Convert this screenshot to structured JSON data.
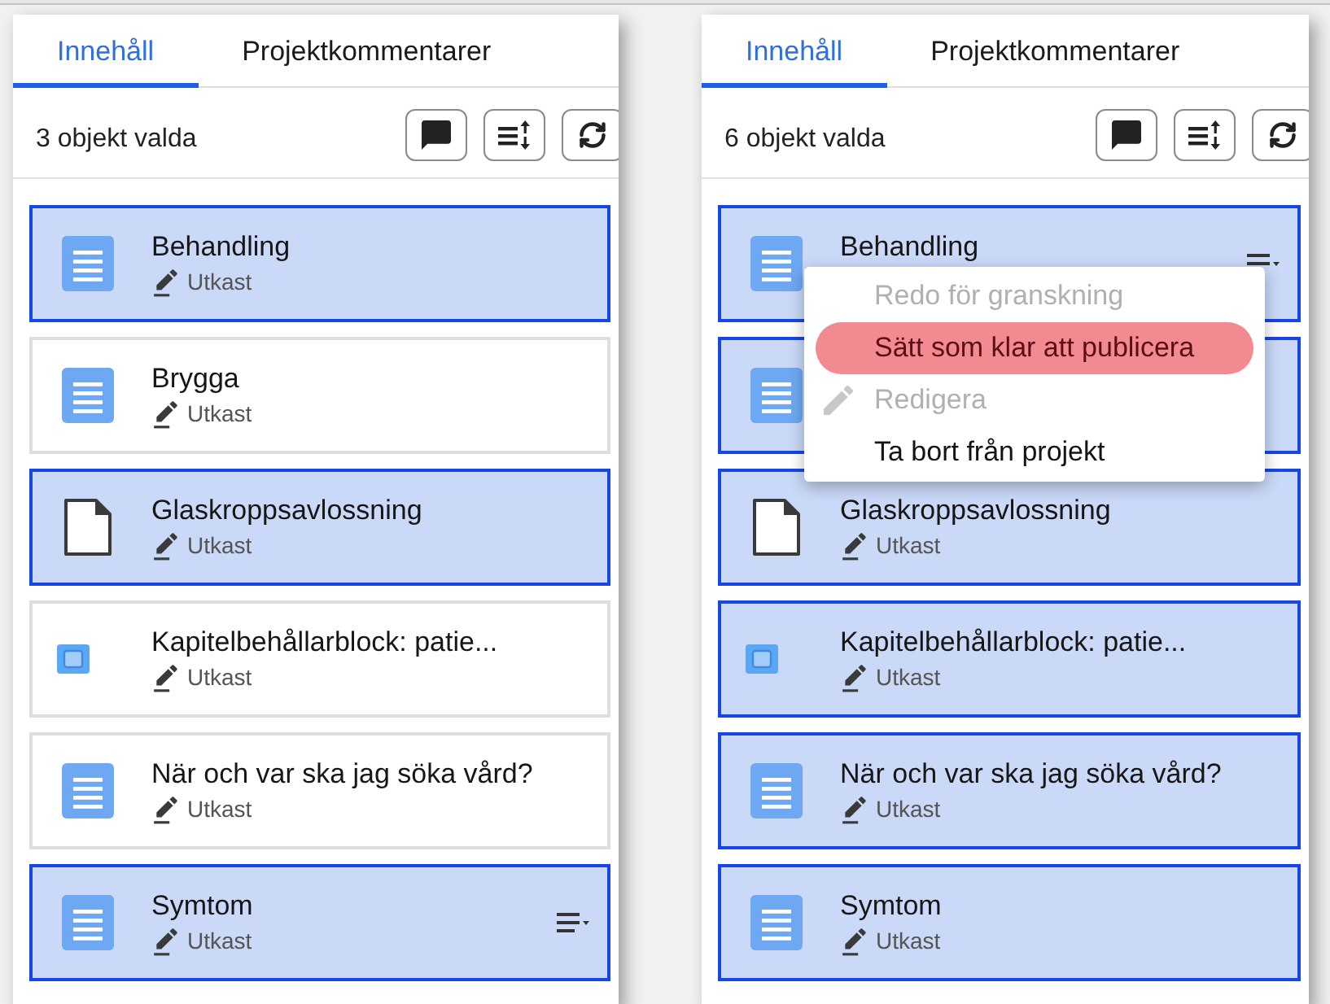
{
  "panels": [
    {
      "tabs": [
        {
          "label": "Innehåll",
          "selected": true
        },
        {
          "label": "Projektkommentarer",
          "selected": false
        }
      ],
      "selection_count": "3 objekt valda",
      "items": [
        {
          "title": "Behandling",
          "status": "Utkast",
          "kind": "text",
          "selected": true,
          "menu_button": false
        },
        {
          "title": "Brygga",
          "status": "Utkast",
          "kind": "text",
          "selected": false,
          "menu_button": false
        },
        {
          "title": "Glaskroppsavlossning",
          "status": "Utkast",
          "kind": "page",
          "selected": true,
          "menu_button": false
        },
        {
          "title": "Kapitelbehållarblock: patie...",
          "status": "Utkast",
          "kind": "block",
          "selected": false,
          "menu_button": false
        },
        {
          "title": "När och var ska jag söka vård?",
          "status": "Utkast",
          "kind": "text",
          "selected": false,
          "menu_button": false
        },
        {
          "title": "Symtom",
          "status": "Utkast",
          "kind": "text",
          "selected": true,
          "menu_button": true
        }
      ]
    },
    {
      "tabs": [
        {
          "label": "Innehåll",
          "selected": true
        },
        {
          "label": "Projektkommentarer",
          "selected": false
        }
      ],
      "selection_count": "6 objekt valda",
      "items": [
        {
          "title": "Behandling",
          "kind": "text",
          "selected": true,
          "menu_button": true,
          "menu": {
            "items": [
              {
                "label": "Redo för granskning",
                "kind": "plain",
                "disabled": true,
                "selected": false
              },
              {
                "label": "Sätt som klar att publicera",
                "kind": "plain",
                "disabled": false,
                "selected": true
              },
              {
                "label": "Redigera",
                "kind": "edit",
                "disabled": true,
                "selected": false
              },
              {
                "label": "Ta bort från projekt",
                "kind": "plain",
                "disabled": false,
                "selected": false
              }
            ]
          }
        },
        {
          "kind": "text",
          "selected": true,
          "menu_button": false
        },
        {
          "title": "Glaskroppsavlossning",
          "status": "Utkast",
          "kind": "page",
          "selected": true,
          "menu_button": false
        },
        {
          "title": "Kapitelbehållarblock: patie...",
          "status": "Utkast",
          "kind": "block",
          "selected": true,
          "menu_button": false
        },
        {
          "title": "När och var ska jag söka vård?",
          "status": "Utkast",
          "kind": "text",
          "selected": true,
          "menu_button": false
        },
        {
          "title": "Symtom",
          "status": "Utkast",
          "kind": "text",
          "selected": true,
          "menu_button": false
        }
      ]
    }
  ]
}
